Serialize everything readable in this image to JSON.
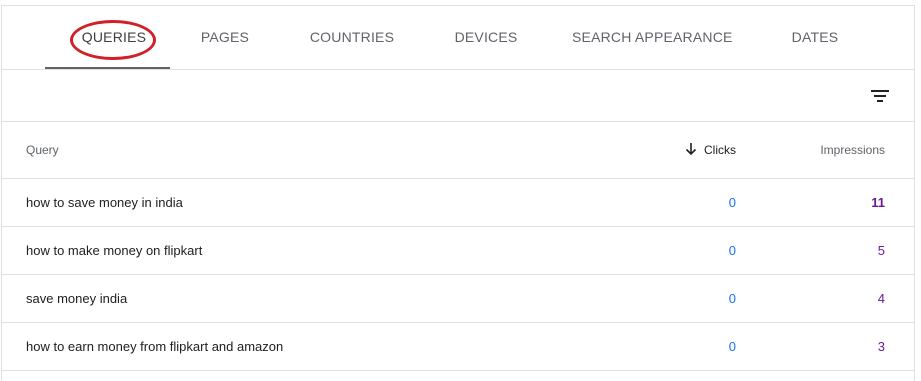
{
  "tabs": [
    {
      "label": "QUERIES",
      "active": true
    },
    {
      "label": "PAGES",
      "active": false
    },
    {
      "label": "COUNTRIES",
      "active": false
    },
    {
      "label": "DEVICES",
      "active": false
    },
    {
      "label": "SEARCH APPEARANCE",
      "active": false
    },
    {
      "label": "DATES",
      "active": false
    }
  ],
  "toolbar": {
    "filter_icon": "filter-icon"
  },
  "table": {
    "headers": {
      "query": "Query",
      "clicks": "Clicks",
      "impressions": "Impressions",
      "sort_icon": "arrow-down-icon"
    },
    "rows": [
      {
        "query": "how to save money in india",
        "clicks": "0",
        "impressions": "11"
      },
      {
        "query": "how to make money on flipkart",
        "clicks": "0",
        "impressions": "5"
      },
      {
        "query": "save money india",
        "clicks": "0",
        "impressions": "4"
      },
      {
        "query": "how to earn money from flipkart and amazon",
        "clicks": "0",
        "impressions": "3"
      }
    ]
  },
  "colors": {
    "clicks": "#1a73e8",
    "impressions": "#6a1b9a",
    "annotation_circle": "#d0202a",
    "active_tab_underline": "#5f6368"
  }
}
